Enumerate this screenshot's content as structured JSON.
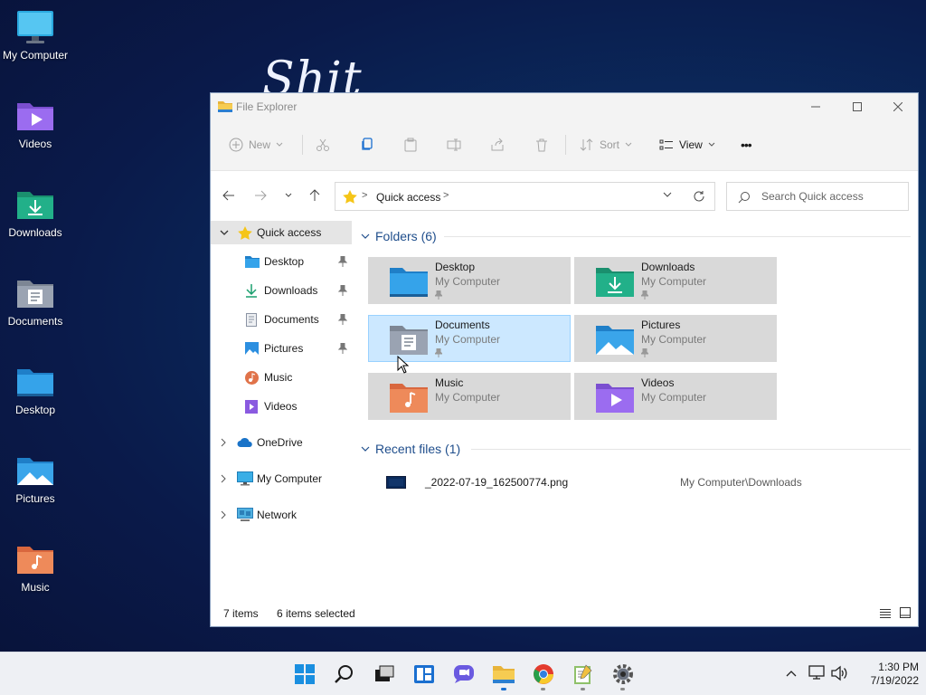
{
  "desktop": {
    "wallpaper_text": "Shit",
    "icons": [
      {
        "label": "My Computer",
        "icon": "monitor-icon"
      },
      {
        "label": "Videos",
        "icon": "videos-folder-icon"
      },
      {
        "label": "Downloads",
        "icon": "downloads-folder-icon"
      },
      {
        "label": "Documents",
        "icon": "documents-folder-icon"
      },
      {
        "label": "Desktop",
        "icon": "desktop-folder-icon"
      },
      {
        "label": "Pictures",
        "icon": "pictures-folder-icon"
      },
      {
        "label": "Music",
        "icon": "music-folder-icon"
      }
    ]
  },
  "window": {
    "title": "File Explorer",
    "toolbar": {
      "new_label": "New",
      "sort_label": "Sort",
      "view_label": "View",
      "more_label": "•••"
    },
    "address": {
      "crumb": "Quick access",
      "sep": ">"
    },
    "search": {
      "placeholder": "Search Quick access"
    },
    "sidebar": {
      "quick_access": "Quick access",
      "items": [
        {
          "label": "Desktop",
          "pinned": true
        },
        {
          "label": "Downloads",
          "pinned": true
        },
        {
          "label": "Documents",
          "pinned": true
        },
        {
          "label": "Pictures",
          "pinned": true
        },
        {
          "label": "Music",
          "pinned": false
        },
        {
          "label": "Videos",
          "pinned": false
        }
      ],
      "roots": [
        {
          "label": "OneDrive"
        },
        {
          "label": "My Computer"
        },
        {
          "label": "Network"
        }
      ]
    },
    "folders_header": "Folders (6)",
    "folders": [
      {
        "name": "Desktop",
        "location": "My Computer",
        "pinned": true,
        "selected": false
      },
      {
        "name": "Downloads",
        "location": "My Computer",
        "pinned": true,
        "selected": false
      },
      {
        "name": "Documents",
        "location": "My Computer",
        "pinned": true,
        "selected": true
      },
      {
        "name": "Pictures",
        "location": "My Computer",
        "pinned": true,
        "selected": false
      },
      {
        "name": "Music",
        "location": "My Computer",
        "pinned": false,
        "selected": false
      },
      {
        "name": "Videos",
        "location": "My Computer",
        "pinned": false,
        "selected": false
      }
    ],
    "recent_header": "Recent files (1)",
    "recent_files": [
      {
        "name": "_2022-07-19_162500774.png",
        "path": "My Computer\\Downloads"
      }
    ],
    "status": {
      "items": "7 items",
      "selected": "6 items selected"
    }
  },
  "taskbar": {
    "time": "1:30 PM",
    "date": "7/19/2022",
    "apps": [
      "start-icon",
      "search-icon",
      "task-view-icon",
      "widgets-icon",
      "chat-icon",
      "file-explorer-icon",
      "chrome-icon",
      "notepad-icon",
      "settings-icon"
    ]
  },
  "colors": {
    "selection": "#cce8ff",
    "tile": "#d9d9d9",
    "section_header": "#1f4e8c"
  }
}
